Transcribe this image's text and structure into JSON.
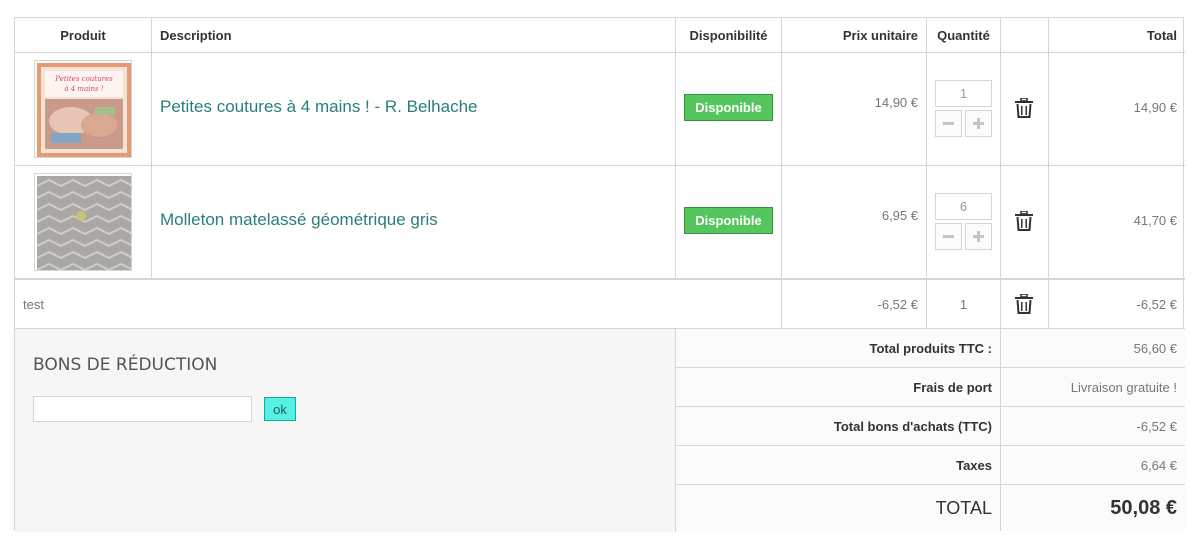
{
  "headers": {
    "product": "Produit",
    "description": "Description",
    "availability": "Disponibilité",
    "unit_price": "Prix unitaire",
    "quantity": "Quantité",
    "total": "Total"
  },
  "items": [
    {
      "name": "Petites coutures à 4 mains ! - R. Belhache",
      "availability": "Disponible",
      "unit_price": "14,90 €",
      "quantity": "1",
      "total": "14,90 €",
      "image_text": "Petites coutures à 4 mains !"
    },
    {
      "name": "Molleton matelassé géométrique gris",
      "availability": "Disponible",
      "unit_price": "6,95 €",
      "quantity": "6",
      "total": "41,70 €"
    }
  ],
  "discount_row": {
    "label": "test",
    "unit_price": "-6,52 €",
    "quantity": "1",
    "total": "-6,52 €"
  },
  "coupon": {
    "title": "Bons de réduction",
    "button_label": "ok",
    "input_value": ""
  },
  "summary": {
    "products_label": "Total produits TTC :",
    "products_value": "56,60 €",
    "shipping_label": "Frais de port",
    "shipping_value": "Livraison gratuite !",
    "vouchers_label": "Total bons d'achats (TTC)",
    "vouchers_value": "-6,52 €",
    "taxes_label": "Taxes",
    "taxes_value": "6,64 €",
    "total_label": "TOTAL",
    "total_value": "50,08 €"
  },
  "colors": {
    "link": "#2a7e7a",
    "available_badge": "#55c65e",
    "ok_button": "#55f2e4"
  },
  "icons": {
    "remove": "trash-icon",
    "decrease": "minus-icon",
    "increase": "plus-icon"
  }
}
